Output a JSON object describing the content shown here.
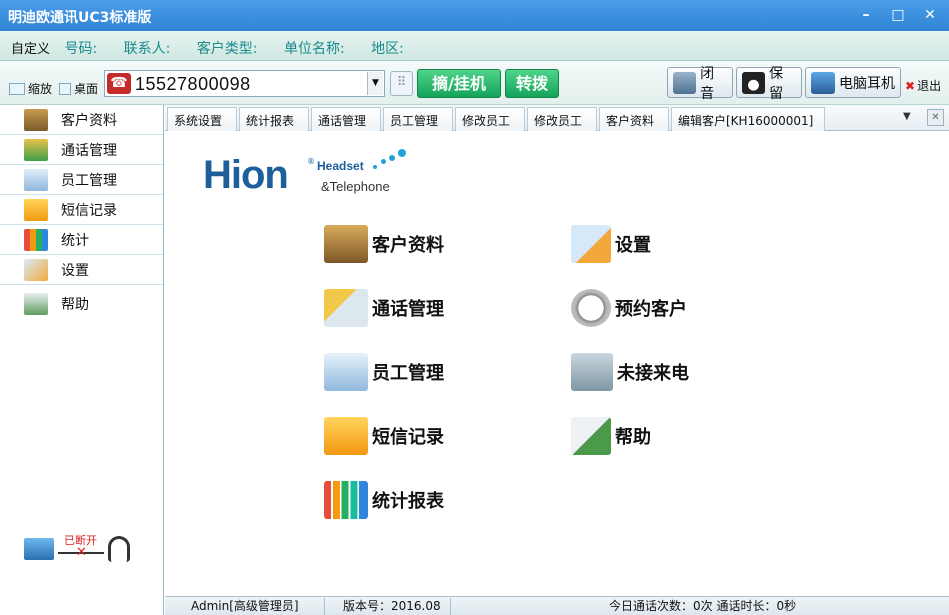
{
  "window": {
    "title": "明迪欧通讯UC3标准版",
    "controls": [
      "minimize-icon",
      "maximize-icon",
      "close-icon"
    ]
  },
  "info_row": {
    "custom": "自定义",
    "fields": [
      "号码:",
      "联系人:",
      "客户类型:",
      "单位名称:",
      "地区:"
    ]
  },
  "toolbar": {
    "shrink": "缩放",
    "desktop": "桌面",
    "phone_number": "15527800098",
    "pickup_hangup": "摘/挂机",
    "transfer": "转拨",
    "mute": "闭音",
    "hold": "保留",
    "pc_headset": "电脑耳机",
    "exit": "退出"
  },
  "sidebar": {
    "items": [
      {
        "label": "客户资料",
        "icon": "customer-icon"
      },
      {
        "label": "通话管理",
        "icon": "call-manage-icon"
      },
      {
        "label": "员工管理",
        "icon": "staff-icon"
      },
      {
        "label": "短信记录",
        "icon": "envelope-icon"
      },
      {
        "label": "统计",
        "icon": "bar-chart-icon"
      },
      {
        "label": "设置",
        "icon": "settings-icon"
      },
      {
        "label": "帮助",
        "icon": "help-icon"
      }
    ],
    "connection_status": "已断开"
  },
  "tabs": [
    "系统设置",
    "统计报表",
    "通话管理",
    "员工管理",
    "修改员工",
    "修改员工",
    "客户资料",
    "编辑客户[KH16000001]"
  ],
  "logo": {
    "mark": "Hion",
    "line1": "Headset",
    "line2": "&Telephone"
  },
  "main_menu": [
    {
      "label": "客户资料",
      "icon": "customer-icon"
    },
    {
      "label": "设置",
      "icon": "settings-icon"
    },
    {
      "label": "通话管理",
      "icon": "call-manage-icon"
    },
    {
      "label": "预约客户",
      "icon": "alarm-clock-icon"
    },
    {
      "label": "员工管理",
      "icon": "staff-icon"
    },
    {
      "label": "未接来电",
      "icon": "missed-call-icon"
    },
    {
      "label": "短信记录",
      "icon": "envelope-icon"
    },
    {
      "label": "帮助",
      "icon": "help-icon"
    },
    {
      "label": "统计报表",
      "icon": "bar-chart-icon"
    }
  ],
  "status": {
    "user": "Admin[高级管理员]",
    "version": "版本号：2016.08",
    "today": "今日通话次数：0次 通话时长：0秒"
  },
  "colors": {
    "title_bar": "#2f84d6",
    "accent_green": "#14a35a",
    "field_label": "#198b8b"
  }
}
